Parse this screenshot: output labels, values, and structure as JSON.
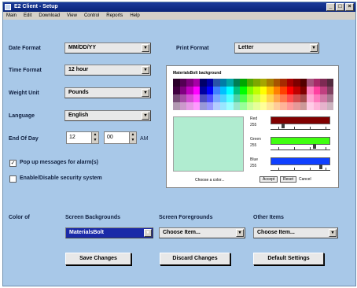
{
  "window": {
    "title": "E2 Client - Setup",
    "buttons": [
      "_",
      "□",
      "×"
    ]
  },
  "menu": [
    "Main",
    "Edit",
    "Download",
    "View",
    "Control",
    "Reports",
    "Help"
  ],
  "settings": {
    "date_format": {
      "label": "Date Format",
      "value": "MM/DD/YY"
    },
    "time_format": {
      "label": "Time Format",
      "value": "12 hour"
    },
    "weight_unit": {
      "label": "Weight Unit",
      "value": "Pounds"
    },
    "language": {
      "label": "Language",
      "value": "English"
    },
    "end_of_day": {
      "label": "End Of Day",
      "hour": "12",
      "minute": "00",
      "ampm": "AM"
    },
    "print_format": {
      "label": "Print Format",
      "value": "Letter"
    }
  },
  "checkboxes": {
    "popup": {
      "label": "Pop up messages for alarm(s)",
      "checked": "✓"
    },
    "security": {
      "label": "Enable/Disable security system",
      "checked": ""
    }
  },
  "preview": {
    "title": "MaterialsBolt background",
    "red": {
      "label": "Red",
      "max": "255"
    },
    "green": {
      "label": "Green",
      "max": "255"
    },
    "blue": {
      "label": "Blue",
      "max": "255"
    },
    "footer": "Choose a color...",
    "accept": "Accept",
    "reset": "Reset",
    "cancel": "Cancel"
  },
  "colors": {
    "label": "Color of",
    "screen_bg": {
      "heading": "Screen Backgrounds",
      "value": "MaterialsBolt"
    },
    "screen_fg": {
      "heading": "Screen Foregrounds",
      "value": "Choose Item..."
    },
    "other": {
      "heading": "Other Items",
      "value": "Choose Item..."
    }
  },
  "actions": {
    "save": "Save Changes",
    "discard": "Discard Changes",
    "default": "Default Settings"
  },
  "palette_colors": [
    "#400040",
    "#800080",
    "#c000c0",
    "#ff00ff",
    "#0000a0",
    "#0000ff",
    "#4080ff",
    "#00c0ff",
    "#00ffff",
    "#00c080",
    "#00ff00",
    "#80ff00",
    "#c0ff00",
    "#ffff00",
    "#ffc000",
    "#ff8000",
    "#ff4000",
    "#ff0000",
    "#c00000",
    "#800000",
    "#ff80c0",
    "#ff40a0",
    "#c04080",
    "#804060"
  ],
  "accent_colors": {
    "red": "#800000",
    "green": "#40ff10",
    "blue": "#1040ff",
    "swatch": "#b0ecd0"
  }
}
